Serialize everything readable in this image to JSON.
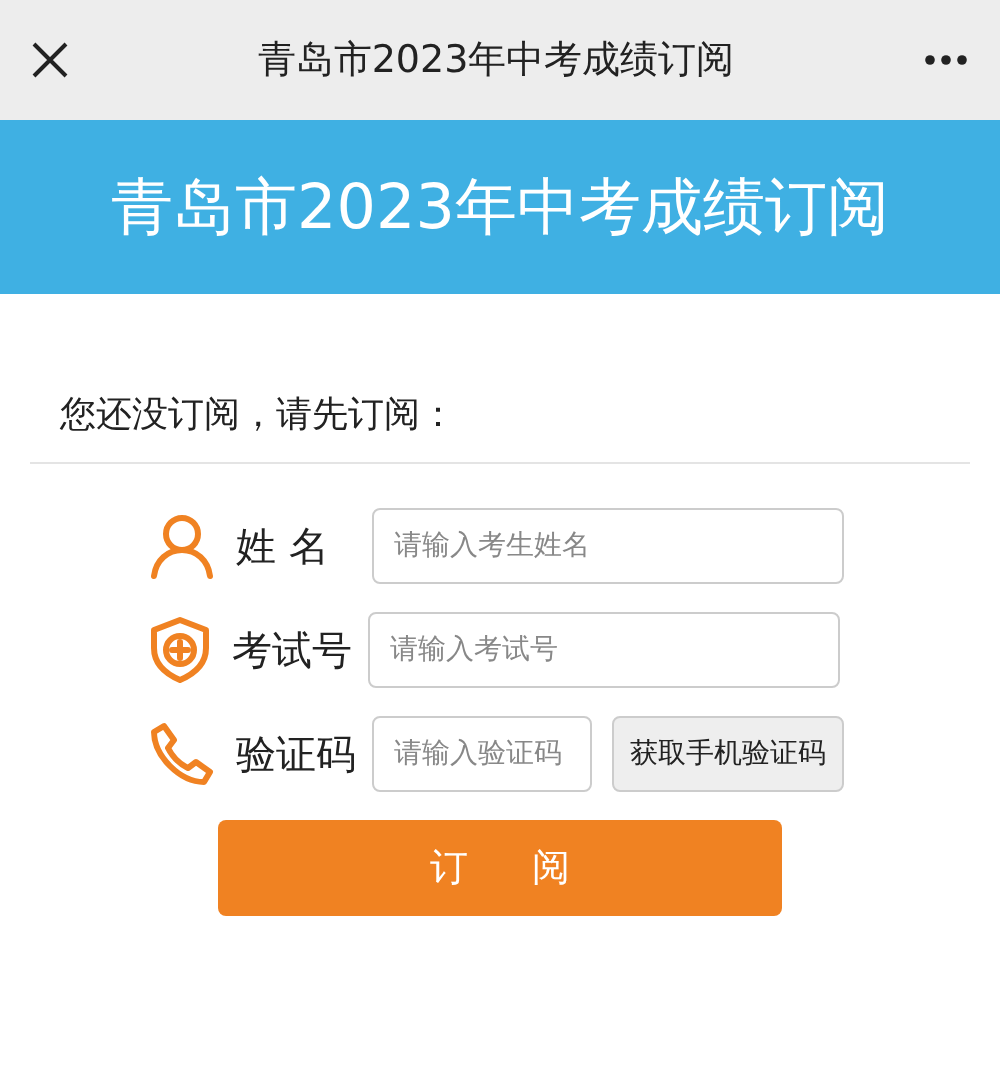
{
  "top_bar": {
    "title": "青岛市2023年中考成绩订阅"
  },
  "banner": {
    "title": "青岛市2023年中考成绩订阅"
  },
  "prompt": "您还没订阅，请先订阅：",
  "fields": [
    {
      "kind": "person",
      "label": "姓 名",
      "placeholder": "请输入考生姓名"
    },
    {
      "kind": "shield",
      "label": "考试号",
      "placeholder": "请输入考试号"
    },
    {
      "kind": "phone",
      "label": "验证码",
      "placeholder": "请输入验证码",
      "button": "获取手机验证码"
    }
  ],
  "submit": "订 阅"
}
